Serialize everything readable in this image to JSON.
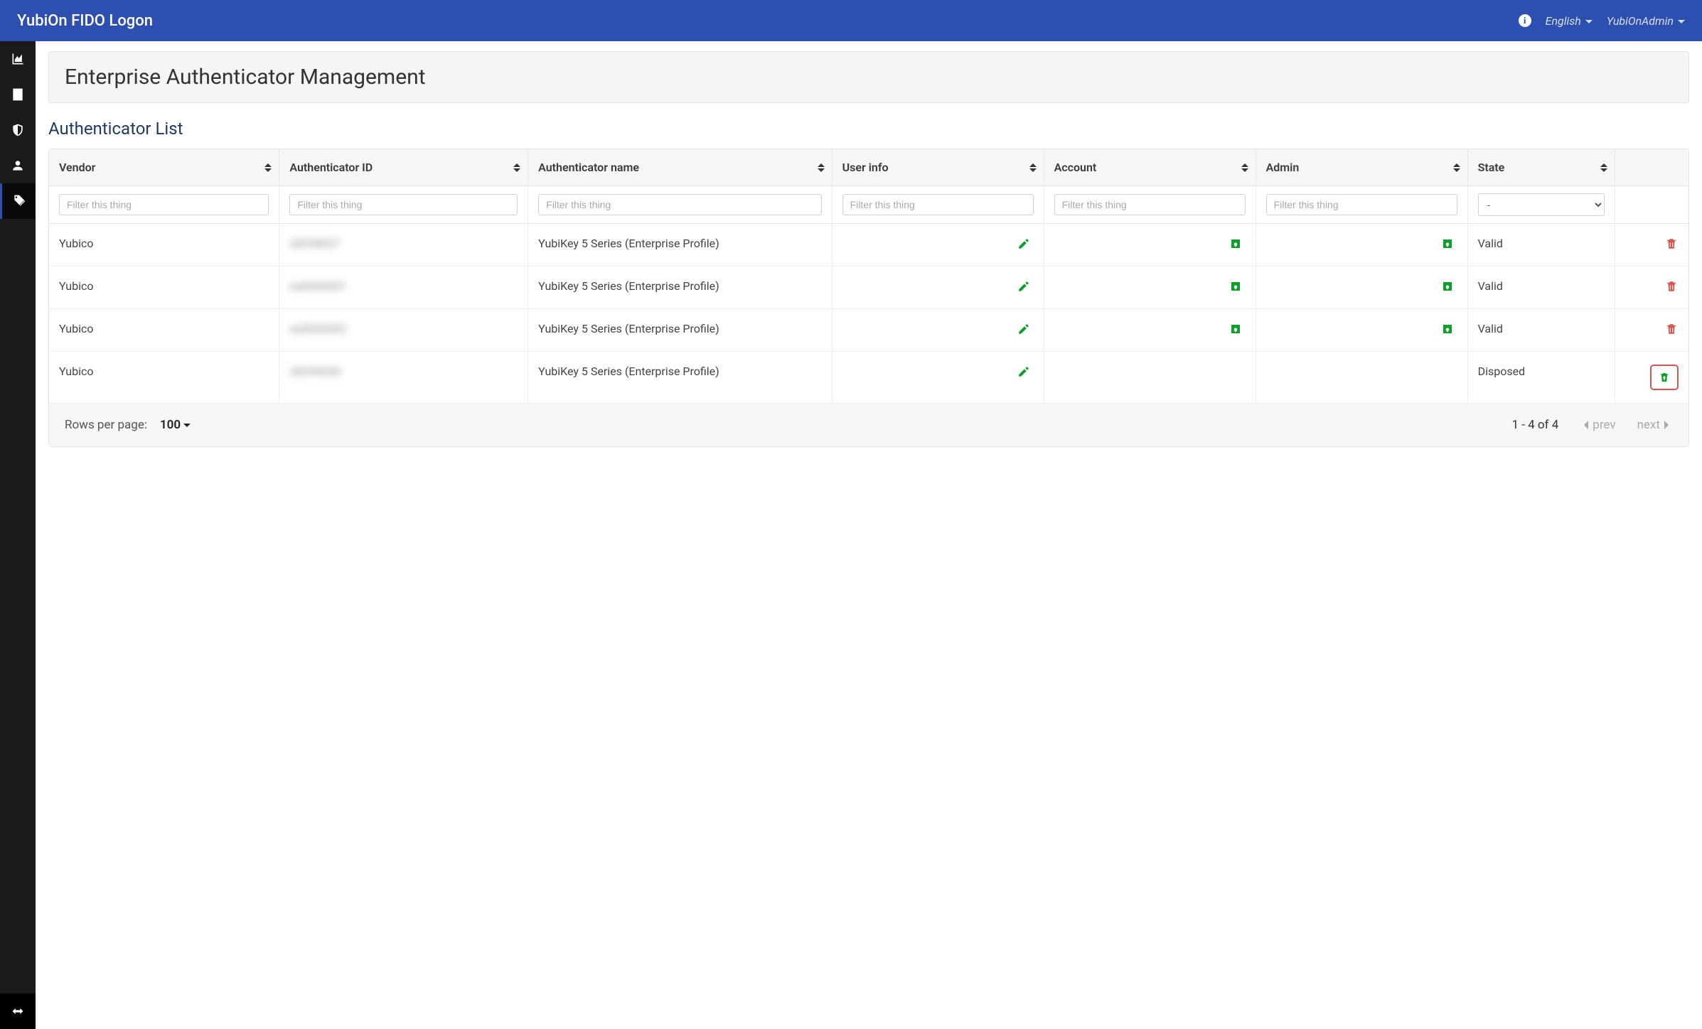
{
  "brand": "YubiOn FIDO Logon",
  "top": {
    "language": "English",
    "user": "YubiOnAdmin"
  },
  "page": {
    "title": "Enterprise Authenticator Management",
    "section": "Authenticator List"
  },
  "columns": {
    "vendor": "Vendor",
    "auth_id": "Authenticator ID",
    "auth_name": "Authenticator name",
    "user_info": "User info",
    "account": "Account",
    "admin": "Admin",
    "state": "State"
  },
  "filter_placeholder": "Filter this thing",
  "state_filter_default": "-",
  "rows": [
    {
      "vendor": "Yubico",
      "auth_id": "28298027",
      "auth_name": "YubiKey 5 Series (Enterprise Profile)",
      "state": "Valid",
      "has_account": true,
      "has_admin": true,
      "action": "delete"
    },
    {
      "vendor": "Yubico",
      "auth_id": "ea0000001",
      "auth_name": "YubiKey 5 Series (Enterprise Profile)",
      "state": "Valid",
      "has_account": true,
      "has_admin": true,
      "action": "delete"
    },
    {
      "vendor": "Yubico",
      "auth_id": "ea0000002",
      "auth_name": "YubiKey 5 Series (Enterprise Profile)",
      "state": "Valid",
      "has_account": true,
      "has_admin": true,
      "action": "delete"
    },
    {
      "vendor": "Yubico",
      "auth_id": "28296030",
      "auth_name": "YubiKey 5 Series (Enterprise Profile)",
      "state": "Disposed",
      "has_account": false,
      "has_admin": false,
      "action": "restore"
    }
  ],
  "footer": {
    "rpp_label": "Rows per page:",
    "rpp_value": "100",
    "range": "1 - 4 of 4",
    "prev": "prev",
    "next": "next"
  }
}
